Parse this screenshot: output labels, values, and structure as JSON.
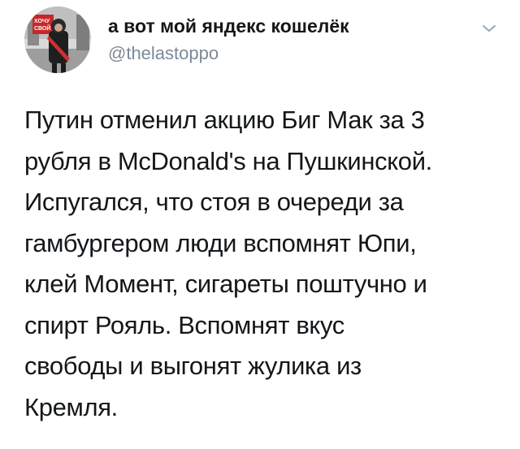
{
  "tweet": {
    "author": {
      "display_name": "а вот мой яндекс кошелёк",
      "handle": "@thelastoppo",
      "avatar_sign_text": "ХОЧУ СВОЙ"
    },
    "menu_icon": "chevron-down-icon",
    "text_lines": [
      "Путин отменил акцию Биг Мак за 3",
      "рубля в McDonald's на Пушкинской.",
      "Испугался, что стоя в очереди за",
      "гамбургером люди вспомнят Юпи,",
      "клей Момент, сигареты поштучно и",
      "спирт Рояль. Вспомнят вкус",
      "свободы и выгонят жулика из",
      "Кремля."
    ]
  },
  "colors": {
    "text": "#14171a",
    "secondary_text": "#7b8a96",
    "chevron": "#9aa6b0",
    "background": "#ffffff"
  }
}
